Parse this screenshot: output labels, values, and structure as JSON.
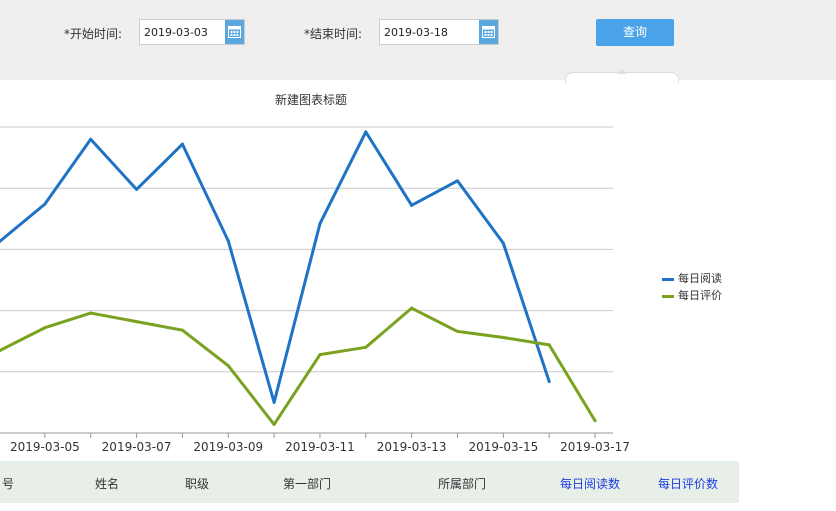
{
  "filters": {
    "start_label": "*开始时间:",
    "start_value": "2019-03-03",
    "end_label": "*结束时间:",
    "end_value": "2019-03-18",
    "query_label": "查询"
  },
  "chart_data": {
    "type": "line",
    "title": "新建图表标题",
    "x": [
      "2019-03-04",
      "2019-03-05",
      "2019-03-06",
      "2019-03-07",
      "2019-03-08",
      "2019-03-09",
      "2019-03-10",
      "2019-03-11",
      "2019-03-12",
      "2019-03-13",
      "2019-03-14",
      "2019-03-15",
      "2019-03-16",
      "2019-03-17"
    ],
    "x_tick_labels": [
      "2019-03-05",
      "2019-03-07",
      "2019-03-09",
      "2019-03-11",
      "2019-03-13",
      "2019-03-15",
      "2019-03-17"
    ],
    "series": [
      {
        "name": "每日阅读",
        "color": "#1f73c5",
        "values": [
          156,
          187,
          240,
          199,
          236,
          157,
          25,
          171,
          246,
          186,
          206,
          155,
          42
        ]
      },
      {
        "name": "每日评价",
        "color": "#78a21f",
        "values": [
          67,
          86,
          98,
          91,
          84,
          55,
          7,
          64,
          70,
          102,
          83,
          78,
          72,
          10
        ]
      }
    ],
    "grid": true,
    "legend_position": "right"
  },
  "table": {
    "headers": [
      {
        "label": "号",
        "link": false
      },
      {
        "label": "姓名",
        "link": false
      },
      {
        "label": "职级",
        "link": false
      },
      {
        "label": "第一部门",
        "link": false
      },
      {
        "label": "所属部门",
        "link": false
      },
      {
        "label": "每日阅读数",
        "link": true
      },
      {
        "label": "每日评价数",
        "link": true
      }
    ]
  }
}
